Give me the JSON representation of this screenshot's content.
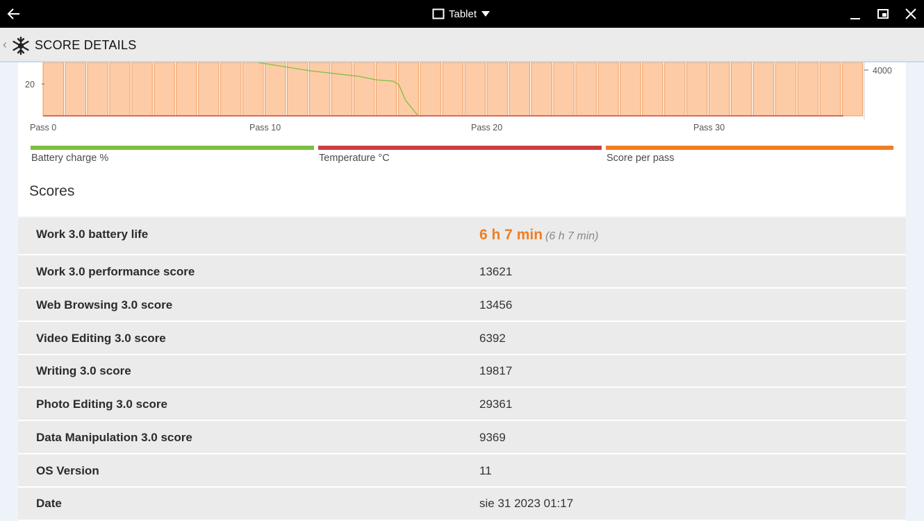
{
  "titlebar": {
    "mode_label": "Tablet"
  },
  "appbar": {
    "title": "SCORE DETAILS"
  },
  "chart_data": {
    "type": "bar",
    "x_ticks": [
      "Pass 0",
      "Pass 10",
      "Pass 20",
      "Pass 30"
    ],
    "left_axis_ticks": [
      "20"
    ],
    "right_axis_ticks": [
      "4000"
    ],
    "bar_count": 37,
    "series": [
      {
        "name": "Battery charge %",
        "color": "#7cc040"
      },
      {
        "name": "Temperature °C",
        "color": "#c9413f"
      },
      {
        "name": "Score per pass",
        "color": "#ef7e22"
      }
    ]
  },
  "scores": {
    "heading": "Scores",
    "rows": [
      {
        "name": "Work 3.0 battery life",
        "value": "6 h 7 min",
        "secondary": "(6 h 7 min)"
      },
      {
        "name": "Work 3.0 performance score",
        "value": "13621"
      },
      {
        "name": "Web Browsing 3.0 score",
        "value": "13456"
      },
      {
        "name": "Video Editing 3.0 score",
        "value": "6392"
      },
      {
        "name": "Writing 3.0 score",
        "value": "19817"
      },
      {
        "name": "Photo Editing 3.0 score",
        "value": "29361"
      },
      {
        "name": "Data Manipulation 3.0 score",
        "value": "9369"
      },
      {
        "name": "OS Version",
        "value": "11"
      },
      {
        "name": "Date",
        "value": "sie 31 2023 01:17"
      }
    ]
  }
}
